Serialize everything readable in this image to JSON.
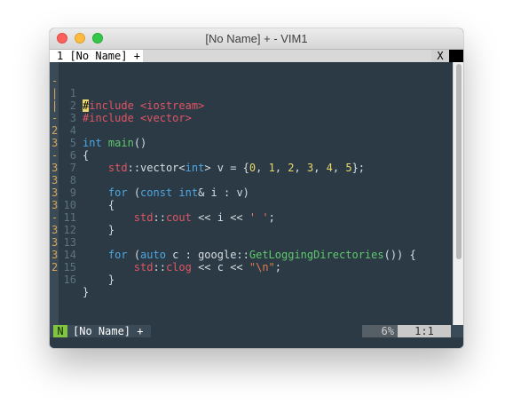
{
  "window": {
    "title": "[No Name] + - VIM1"
  },
  "tabline": {
    "tab_label": "1 [No Name] +",
    "close_label": "X"
  },
  "signs": [
    "-",
    "|",
    "|",
    "-",
    "2",
    "3",
    "-",
    "3",
    "3",
    "3",
    "3",
    "-",
    "3",
    "3",
    "3",
    "2"
  ],
  "line_numbers": [
    "1",
    "2",
    "3",
    "4",
    "5",
    "6",
    "7",
    "8",
    "9",
    "10",
    "11",
    "12",
    "13",
    "14",
    "15",
    "16"
  ],
  "code": {
    "l1_a": "#",
    "l1_b": "include <iostream>",
    "l2": "#include <vector>",
    "l4_kw": "int",
    "l4_fn": "main",
    "l4_rest": "()",
    "l5": "{",
    "l6_ns": "std",
    "l6_sep": "::",
    "l6_a": "vector<",
    "l6_t": "int",
    "l6_b": "> v = {",
    "l6_n0": "0",
    "l6_c0": ", ",
    "l6_n1": "1",
    "l6_c1": ", ",
    "l6_n2": "2",
    "l6_c2": ", ",
    "l6_n3": "3",
    "l6_c3": ", ",
    "l6_n4": "4",
    "l6_c4": ", ",
    "l6_n5": "5",
    "l6_end": "};",
    "l8_for": "for",
    "l8_a": " (",
    "l8_const": "const",
    "l8_sp": " ",
    "l8_int": "int",
    "l8_b": "& i : v)",
    "l9": "{",
    "l10_ns": "std",
    "l10_sep": "::",
    "l10_id": "cout",
    "l10_a": " << i << ",
    "l10_s": "' '",
    "l10_end": ";",
    "l11": "}",
    "l13_for": "for",
    "l13_a": " (",
    "l13_auto": "auto",
    "l13_b": " c : google::",
    "l13_fn": "GetLoggingDirectories",
    "l13_end": "()) {",
    "l14_ns": "std",
    "l14_sep": "::",
    "l14_id": "clog",
    "l14_a": " << c << ",
    "l14_s": "\"\\n\"",
    "l14_end": ";",
    "l15": "}",
    "l16": "}"
  },
  "statusline": {
    "mode": "N",
    "file": "[No Name] +",
    "percent": "6%",
    "position": "1:1"
  }
}
